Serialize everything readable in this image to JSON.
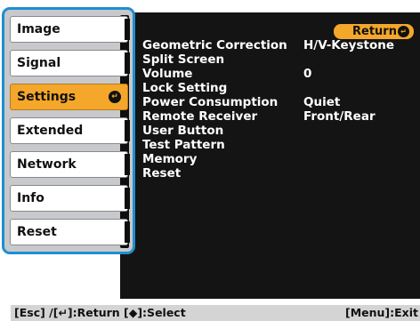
{
  "sidebar": {
    "items": [
      {
        "label": "Image",
        "active": false
      },
      {
        "label": "Signal",
        "active": false
      },
      {
        "label": "Settings",
        "active": true
      },
      {
        "label": "Extended",
        "active": false
      },
      {
        "label": "Network",
        "active": false
      },
      {
        "label": "Info",
        "active": false
      },
      {
        "label": "Reset",
        "active": false
      }
    ],
    "enter_glyph": "↵"
  },
  "return_button": {
    "label": "Return",
    "glyph": "↵"
  },
  "settings": {
    "rows": [
      {
        "label": "Geometric Correction",
        "value": "H/V-Keystone"
      },
      {
        "label": "Split Screen",
        "value": ""
      },
      {
        "label": "Volume",
        "value": "0"
      },
      {
        "label": "Lock Setting",
        "value": ""
      },
      {
        "label": "Power Consumption",
        "value": "Quiet"
      },
      {
        "label": "Remote Receiver",
        "value": "Front/Rear"
      },
      {
        "label": "User Button",
        "value": ""
      },
      {
        "label": "Test Pattern",
        "value": ""
      },
      {
        "label": "Memory",
        "value": ""
      },
      {
        "label": "Reset",
        "value": ""
      }
    ]
  },
  "footer": {
    "left": "[Esc] /[↵]:Return  [◆]:Select",
    "right": "[Menu]:Exit"
  },
  "colors": {
    "accent": "#f4a72a",
    "sidebar_border": "#1e8fd0",
    "screen_bg": "#141414"
  }
}
